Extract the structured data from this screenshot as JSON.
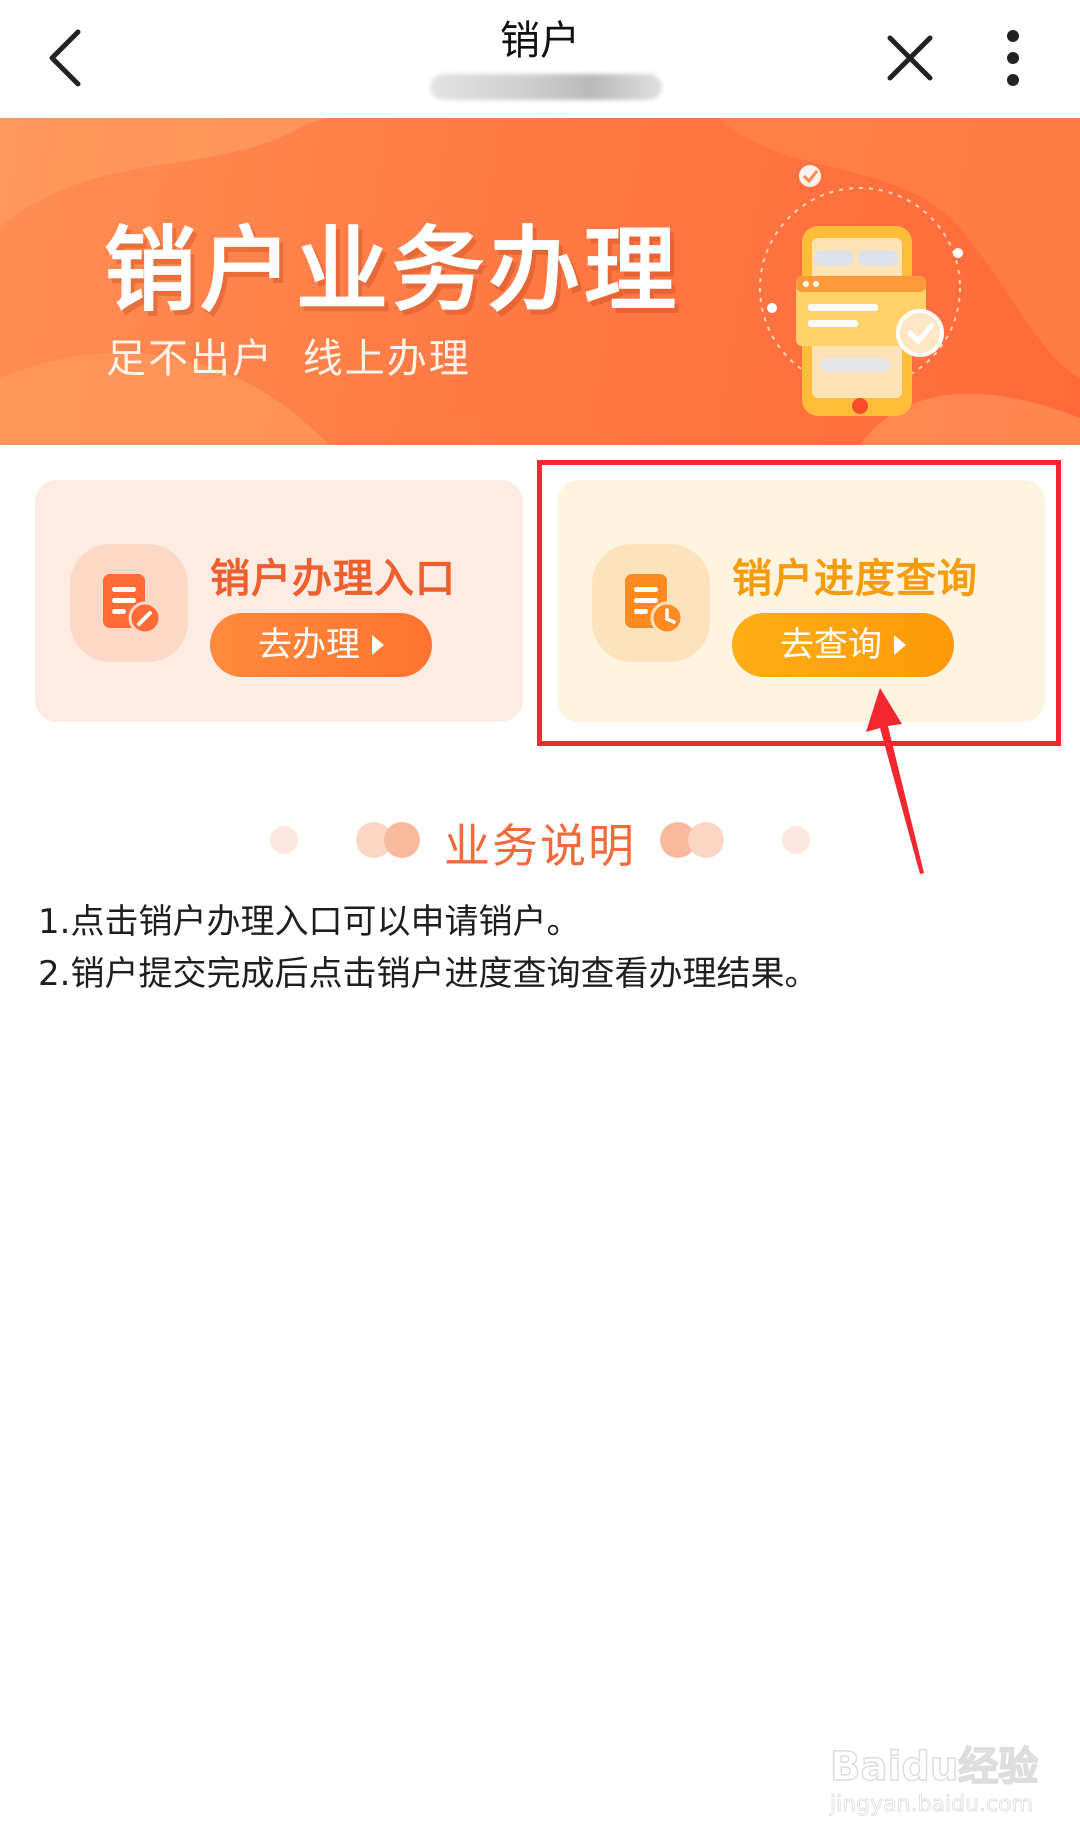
{
  "navbar": {
    "title": "销户"
  },
  "banner": {
    "title": "销户业务办理",
    "subtitle": "足不出户  线上办理"
  },
  "cards": {
    "apply": {
      "title": "销户办理入口",
      "button": "去办理"
    },
    "query": {
      "title": "销户进度查询",
      "button": "去查询"
    }
  },
  "section": {
    "title": "业务说明"
  },
  "description": {
    "lines": [
      "1.点击销户办理入口可以申请销户。",
      "2.销户提交完成后点击销户进度查询查看办理结果。"
    ]
  },
  "watermark": {
    "brand": "Baidu经验",
    "url": "jingyan.baidu.com"
  },
  "colors": {
    "banner": "#ff7a44",
    "apply_accent": "#ee5f2e",
    "query_accent": "#f59c0e",
    "annotation": "#f2272f"
  },
  "icons": {
    "back": "chevron-left-icon",
    "close": "close-icon",
    "more": "more-vertical-icon",
    "apply": "document-edit-icon",
    "query": "document-clock-icon"
  }
}
